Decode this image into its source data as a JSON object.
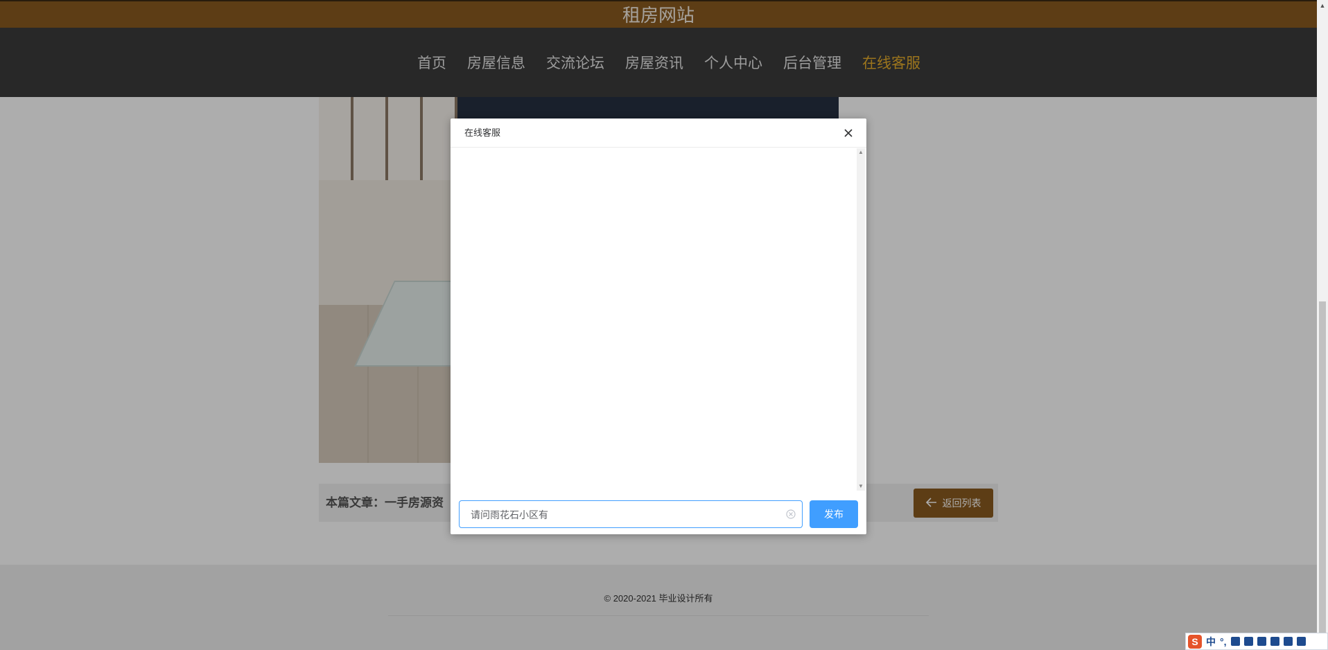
{
  "site": {
    "title": "租房网站"
  },
  "nav": {
    "items": [
      {
        "label": "首页"
      },
      {
        "label": "房屋信息"
      },
      {
        "label": "交流论坛"
      },
      {
        "label": "房屋资讯"
      },
      {
        "label": "个人中心"
      },
      {
        "label": "后台管理"
      },
      {
        "label": "在线客服"
      }
    ],
    "active_index": 6
  },
  "article": {
    "title": "本篇文章：一手房源资",
    "back_label": "返回列表"
  },
  "footer": {
    "copyright": "© 2020-2021 毕业设计所有"
  },
  "dialog": {
    "title": "在线客服",
    "input_value": "请问雨花石小区有",
    "send_label": "发布"
  },
  "ime": {
    "mode_label": "中",
    "punct_label": "°,"
  },
  "colors": {
    "topbar": "#8a5a20",
    "navbar": "#3b3b3b",
    "nav_active": "#e6ad2b",
    "primary": "#409eff",
    "back_button": "#8a5a20"
  },
  "icons": {
    "close": "close-icon",
    "clear": "circle-close-icon",
    "back": "arrow-left-icon"
  }
}
